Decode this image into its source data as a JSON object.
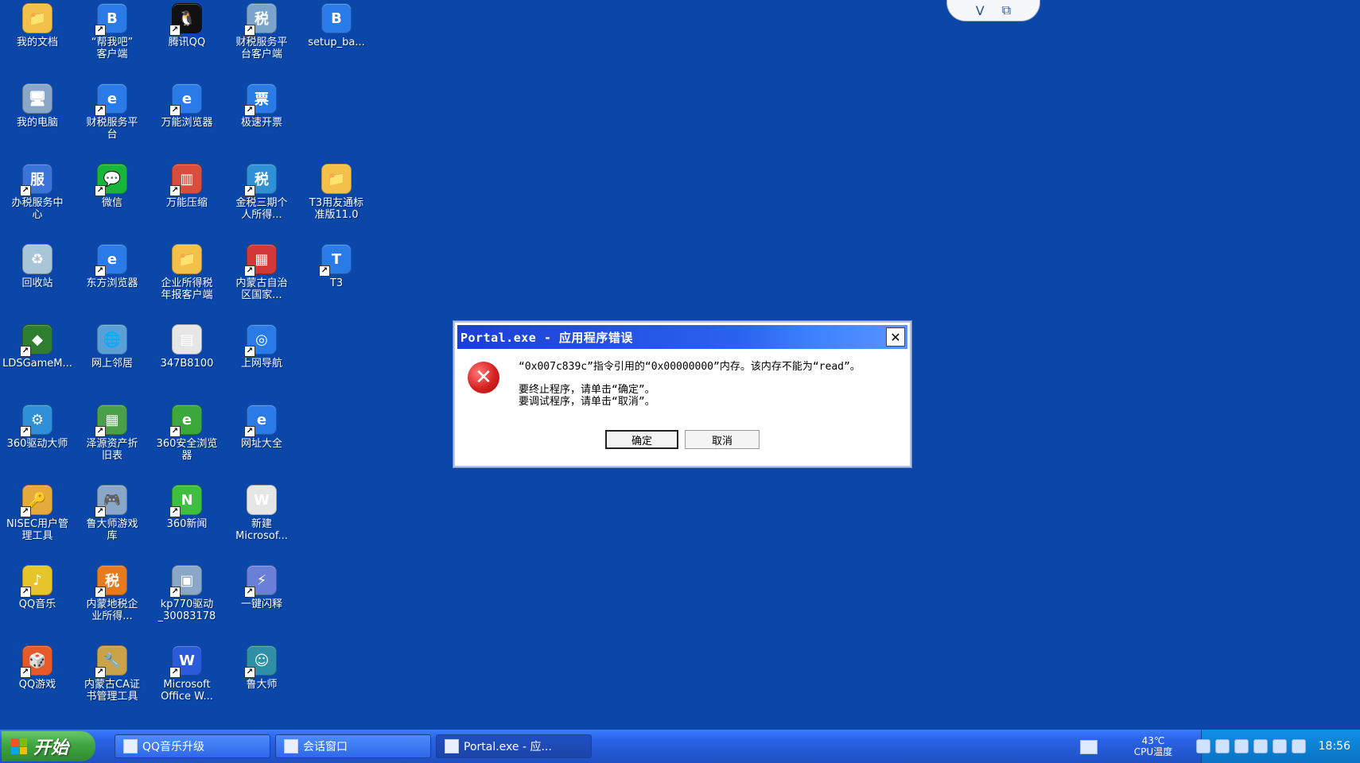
{
  "desktop": {
    "icons": [
      {
        "label": "我的文档",
        "emoji": "📁",
        "color": "#f3c04a",
        "shortcut": false
      },
      {
        "label": "“帮我吧”\n客户端",
        "emoji": "B",
        "color": "#2a7be8",
        "shortcut": true
      },
      {
        "label": "腾讯QQ",
        "emoji": "🐧",
        "color": "#111111",
        "shortcut": true
      },
      {
        "label": "财税服务平\n台客户端",
        "emoji": "税",
        "color": "#7aa4cc",
        "shortcut": true
      },
      {
        "label": "setup_ba...",
        "emoji": "B",
        "color": "#2a7be8",
        "shortcut": false
      },
      {
        "label": "我的电脑",
        "emoji": "🖥",
        "color": "#8aa7c7",
        "shortcut": false
      },
      {
        "label": "财税服务平\n台",
        "emoji": "e",
        "color": "#2a7be8",
        "shortcut": true
      },
      {
        "label": "万能浏览器",
        "emoji": "e",
        "color": "#2a7be8",
        "shortcut": true
      },
      {
        "label": "极速开票",
        "emoji": "票",
        "color": "#2a7be8",
        "shortcut": true
      },
      {
        "label": "办税服务中\n心",
        "emoji": "服",
        "color": "#3a74d8",
        "shortcut": true
      },
      {
        "label": "微信",
        "emoji": "💬",
        "color": "#19b53a",
        "shortcut": true
      },
      {
        "label": "万能压缩",
        "emoji": "▥",
        "color": "#d84d3c",
        "shortcut": true
      },
      {
        "label": "金税三期个\n人所得...",
        "emoji": "税",
        "color": "#2f90d6",
        "shortcut": true
      },
      {
        "label": "T3用友通标\n准版11.0",
        "emoji": "📁",
        "color": "#f3c04a",
        "shortcut": false
      },
      {
        "label": "回收站",
        "emoji": "♻",
        "color": "#a9c5d8",
        "shortcut": false
      },
      {
        "label": "东方浏览器",
        "emoji": "e",
        "color": "#2a7be8",
        "shortcut": true
      },
      {
        "label": "企业所得税\n年报客户端",
        "emoji": "📁",
        "color": "#f3c04a",
        "shortcut": false
      },
      {
        "label": "内蒙古自治\n区国家...",
        "emoji": "▦",
        "color": "#d23838",
        "shortcut": true
      },
      {
        "label": "T3",
        "emoji": "T",
        "color": "#2a7be8",
        "shortcut": true
      },
      {
        "label": "LDSGameM...",
        "emoji": "◆",
        "color": "#2f7d2f",
        "shortcut": true
      },
      {
        "label": "网上邻居",
        "emoji": "🌐",
        "color": "#5aa0d8",
        "shortcut": false
      },
      {
        "label": "347B8100",
        "emoji": "▤",
        "color": "#e6e6e6",
        "shortcut": false
      },
      {
        "label": "上网导航",
        "emoji": "◎",
        "color": "#2a7be8",
        "shortcut": true
      },
      {
        "label": "360驱动大师",
        "emoji": "⚙",
        "color": "#2f8fd8",
        "shortcut": true
      },
      {
        "label": "泽源资产折\n旧表",
        "emoji": "▦",
        "color": "#4aa04a",
        "shortcut": true
      },
      {
        "label": "360安全浏览\n器",
        "emoji": "e",
        "color": "#3aa83a",
        "shortcut": true
      },
      {
        "label": "网址大全",
        "emoji": "e",
        "color": "#2a7be8",
        "shortcut": true
      },
      {
        "label": "NISEC用户管\n理工具",
        "emoji": "🔑",
        "color": "#e6a93b",
        "shortcut": true
      },
      {
        "label": "鲁大师游戏\n库",
        "emoji": "🎮",
        "color": "#8aa7c7",
        "shortcut": true
      },
      {
        "label": "360新闻",
        "emoji": "N",
        "color": "#3fbf3f",
        "shortcut": true
      },
      {
        "label": "新建\nMicrosof...",
        "emoji": "W",
        "color": "#e6e6e6",
        "shortcut": false
      },
      {
        "label": "QQ音乐",
        "emoji": "♪",
        "color": "#e6c52a",
        "shortcut": true
      },
      {
        "label": "内蒙地税企\n业所得...",
        "emoji": "税",
        "color": "#e67a1f",
        "shortcut": true
      },
      {
        "label": "kp770驱动\n_30083178",
        "emoji": "▣",
        "color": "#8aa7c7",
        "shortcut": true
      },
      {
        "label": "一键闪释",
        "emoji": "⚡",
        "color": "#6a7fd8",
        "shortcut": true
      },
      {
        "label": "QQ游戏",
        "emoji": "🎲",
        "color": "#e65a2a",
        "shortcut": true
      },
      {
        "label": "内蒙古CA证\n书管理工具",
        "emoji": "🔧",
        "color": "#c9a24a",
        "shortcut": true
      },
      {
        "label": "Microsoft\nOffice W...",
        "emoji": "W",
        "color": "#2a5bd8",
        "shortcut": true
      },
      {
        "label": "鲁大师",
        "emoji": "☺",
        "color": "#2f8fa6",
        "shortcut": true
      }
    ]
  },
  "top_notch": {
    "left_icon": "V",
    "right_icon": "⧉"
  },
  "dialog": {
    "title": "Portal.exe - 应用程序错误",
    "close_label": "✕",
    "message_line1": "“0x007c839c”指令引用的“0x00000000”内存。该内存不能为“read”。",
    "message_line2": "要终止程序，请单击“确定”。",
    "message_line3": "要调试程序，请单击“取消”。",
    "ok_label": "确定",
    "cancel_label": "取消"
  },
  "taskbar": {
    "start_label": "开始",
    "tasks": [
      {
        "label": "QQ音乐升级",
        "active": false
      },
      {
        "label": "会话窗口",
        "active": false
      },
      {
        "label": "Portal.exe - 应...",
        "active": true
      }
    ],
    "cpu_temp": "43℃",
    "cpu_label": "CPU温度",
    "time": "18:56"
  }
}
